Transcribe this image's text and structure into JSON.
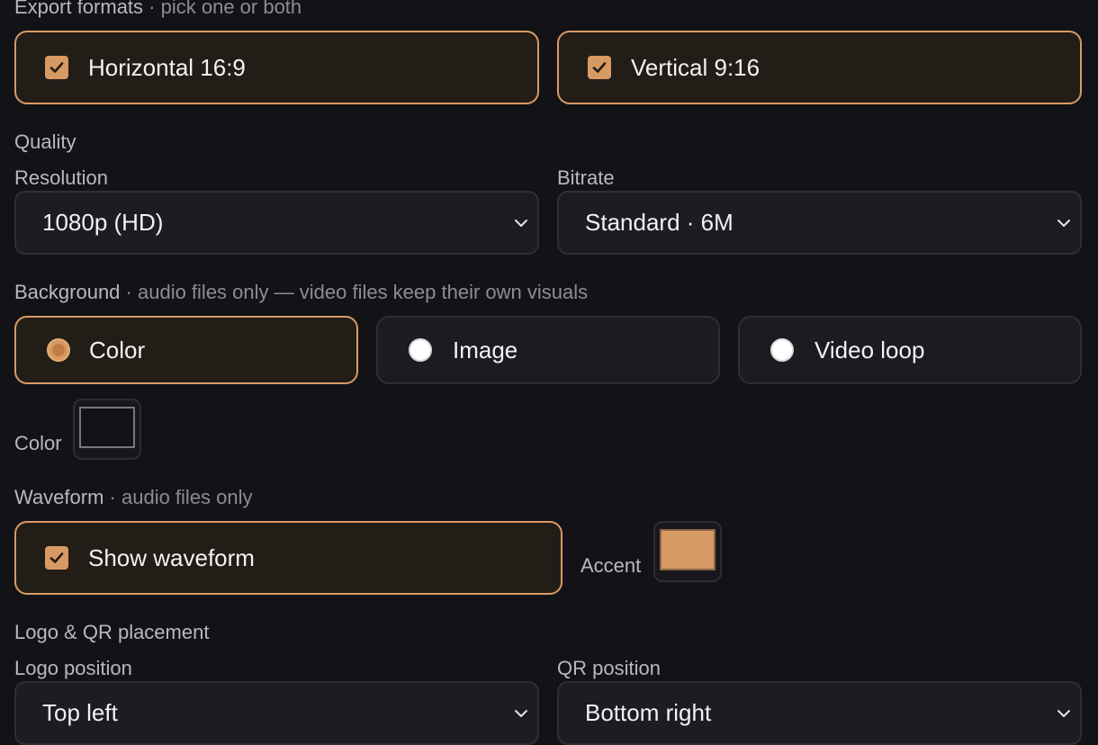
{
  "export": {
    "heading": "Export formats",
    "hint": "· pick one or both",
    "options": [
      {
        "label": "Horizontal 16:9",
        "checked": true
      },
      {
        "label": "Vertical 9:16",
        "checked": true
      }
    ]
  },
  "quality": {
    "heading": "Quality",
    "resolution": {
      "label": "Resolution",
      "value": "1080p (HD)"
    },
    "bitrate": {
      "label": "Bitrate",
      "value": "Standard · 6M"
    }
  },
  "background": {
    "heading": "Background",
    "hint": "· audio files only — video files keep their own visuals",
    "options": [
      {
        "label": "Color",
        "selected": true
      },
      {
        "label": "Image",
        "selected": false
      },
      {
        "label": "Video loop",
        "selected": false
      }
    ],
    "color_label": "Color",
    "color_value": "#131317"
  },
  "waveform": {
    "heading": "Waveform",
    "hint": "· audio files only",
    "show_label": "Show waveform",
    "show_checked": true,
    "accent_label": "Accent",
    "accent_color": "#d89a64"
  },
  "placement": {
    "heading": "Logo & QR placement",
    "logo": {
      "label": "Logo position",
      "value": "Top left"
    },
    "qr": {
      "label": "QR position",
      "value": "Bottom right"
    }
  },
  "colors": {
    "accent": "#d89a64",
    "selected_bg": "#231d17",
    "page_bg": "#131317"
  }
}
